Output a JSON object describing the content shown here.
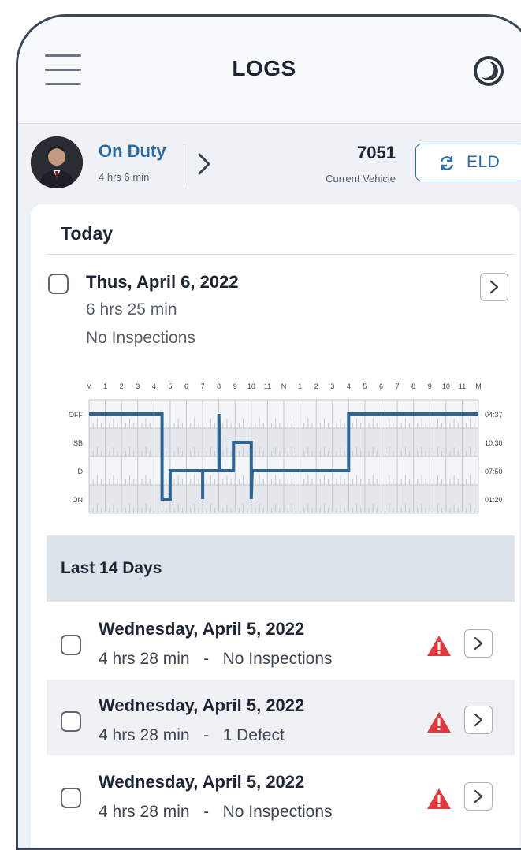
{
  "header": {
    "title": "LOGS",
    "menu_icon": "hamburger-menu-icon",
    "theme_icon": "half-moon-contrast-icon"
  },
  "status": {
    "duty_label": "On Duty",
    "duty_time": "4 hrs 6 min",
    "vehicle_number": "7051",
    "vehicle_label": "Current Vehicle",
    "eld_label": "ELD",
    "eld_icon": "sync-arrows-icon"
  },
  "today": {
    "heading": "Today",
    "date": "Thus, April 6, 2022",
    "hours": "6 hrs 25 min",
    "inspections": "No Inspections"
  },
  "chart_data": {
    "type": "line",
    "x_tick_labels": [
      "M",
      "1",
      "2",
      "3",
      "4",
      "5",
      "6",
      "7",
      "8",
      "9",
      "10",
      "11",
      "N",
      "1",
      "2",
      "3",
      "4",
      "5",
      "6",
      "7",
      "8",
      "9",
      "10",
      "11",
      "M"
    ],
    "status_labels": [
      "OFF",
      "SB",
      "D",
      "ON"
    ],
    "totals": [
      "04:37",
      "10:30",
      "07:50",
      "01:20"
    ],
    "xlim": [
      0,
      24
    ],
    "grid": true,
    "series": [
      {
        "points": [
          [
            0,
            "OFF"
          ],
          [
            4.5,
            "OFF"
          ],
          [
            4.5,
            "ON"
          ],
          [
            5.0,
            "ON"
          ],
          [
            5.0,
            "D"
          ],
          [
            7.0,
            "D"
          ],
          [
            7.0,
            "ON"
          ],
          [
            7.0,
            "D"
          ],
          [
            8.0,
            "D"
          ],
          [
            8.0,
            "OFF"
          ],
          [
            8.05,
            "D"
          ],
          [
            8.9,
            "D"
          ],
          [
            8.9,
            "SB"
          ],
          [
            10.0,
            "SB"
          ],
          [
            10.0,
            "ON"
          ],
          [
            10.05,
            "D"
          ],
          [
            16.0,
            "D"
          ],
          [
            16.0,
            "OFF"
          ],
          [
            24,
            "OFF"
          ]
        ]
      }
    ]
  },
  "last14": {
    "heading": "Last 14 Days",
    "rows": [
      {
        "date": "Wednesday, April 5, 2022",
        "hours": "4 hrs 28 min",
        "sep": "-",
        "note": "No Inspections"
      },
      {
        "date": "Wednesday, April 5, 2022",
        "hours": "4 hrs 28 min",
        "sep": "-",
        "note": "1 Defect"
      },
      {
        "date": "Wednesday, April 5, 2022",
        "hours": "4 hrs 28 min",
        "sep": "-",
        "note": "No Inspections"
      }
    ]
  },
  "colors": {
    "accent": "#2a6aa5",
    "chart_line": "#2e6595",
    "warning": "#e03a3e",
    "section_bg": "#dde3ea"
  }
}
